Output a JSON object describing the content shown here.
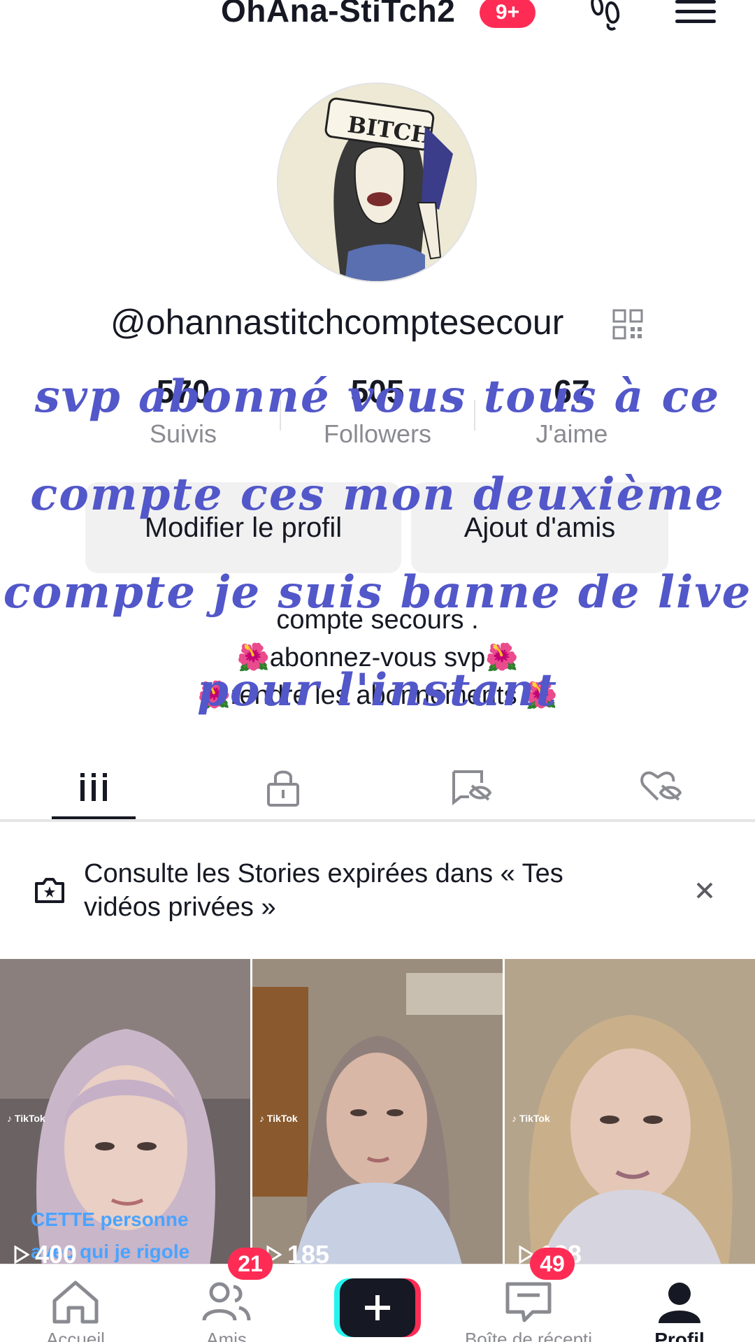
{
  "header": {
    "title": "OhAna-StiTch2",
    "badge": "9+"
  },
  "profile": {
    "username": "@ohannastitchcomptesecour",
    "stats": [
      {
        "value": "570",
        "label": "Suivis"
      },
      {
        "value": "505",
        "label": "Followers"
      },
      {
        "value": "67",
        "label": "J'aime"
      }
    ],
    "buttons": {
      "edit": "Modifier le profil",
      "add_friends": "Ajout d'amis"
    },
    "bio_lines": [
      "compte secours .",
      "🌺abonnez-vous svp🌺",
      "🌺rendre les abonnements 🌺"
    ]
  },
  "overlay_text": [
    "svp abonné vous tous à ce",
    "compte ces mon deuxième",
    "compte je suis banne de live",
    "pour l'instant"
  ],
  "tabs": [
    {
      "icon": "grid-icon",
      "active": true
    },
    {
      "icon": "lock-icon",
      "active": false
    },
    {
      "icon": "repost-hidden-icon",
      "active": false
    },
    {
      "icon": "heart-hidden-icon",
      "active": false
    }
  ],
  "story_banner": {
    "text": "Consulte les Stories expirées dans « Tes vidéos privées »"
  },
  "videos": [
    {
      "views": "400",
      "caption_lines": [
        "CETTE personne",
        "avec qui je rigole"
      ]
    },
    {
      "views": "185",
      "caption_lines": []
    },
    {
      "views": "138",
      "caption_lines": []
    }
  ],
  "bottom_nav": [
    {
      "label": "Accueil",
      "icon": "home-icon",
      "active": false
    },
    {
      "label": "Amis",
      "icon": "friends-icon",
      "badge": "21",
      "active": false
    },
    {
      "label": "",
      "icon": "create-plus-icon",
      "active": false
    },
    {
      "label": "Boîte de récepti",
      "icon": "inbox-icon",
      "badge": "49",
      "active": false
    },
    {
      "label": "Profil",
      "icon": "profile-icon",
      "active": true
    }
  ],
  "colors": {
    "accent": "#fe2c55",
    "overlay_ink": "#5257c9",
    "muted_text": "#8a8b91"
  }
}
